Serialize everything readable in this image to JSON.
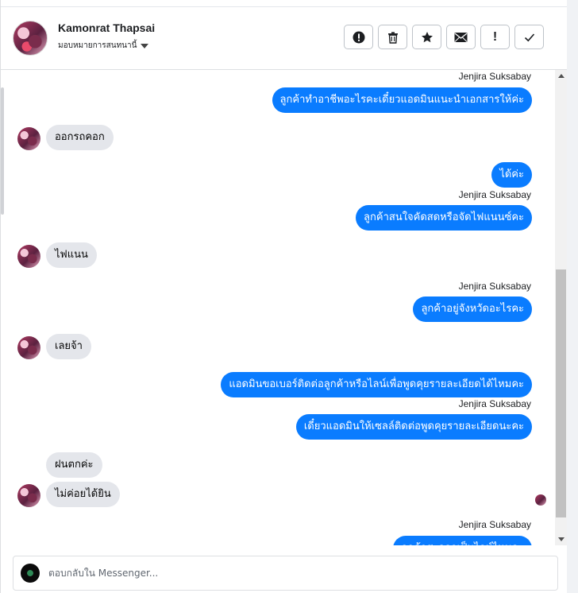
{
  "header": {
    "contact_name": "Kamonrat Thapsai",
    "assign_label": "มอบหมายการสนทนานี้",
    "toolbar": [
      {
        "name": "spam-button",
        "icon": "alert-circle-icon"
      },
      {
        "name": "delete-button",
        "icon": "trash-icon"
      },
      {
        "name": "star-button",
        "icon": "star-icon"
      },
      {
        "name": "unread-button",
        "icon": "envelope-icon"
      },
      {
        "name": "follow-up-button",
        "icon": "exclamation-icon",
        "glyph": "!"
      },
      {
        "name": "done-button",
        "icon": "check-icon"
      }
    ]
  },
  "messages": {
    "m1_sender": "Jenjira Suksabay",
    "m1_text": "ลูกค้าทำอาชีพอะไรคะเดี๋ยวแอดมินแนะนำเอกสารให้ค่ะ",
    "m2_text": "ออกรถคอก",
    "m3_text": "ได้ค่ะ",
    "m4_sender": "Jenjira Suksabay",
    "m4_text": "ลูกค้าสนใจคัดสดหรือจัดไฟแนนซ์คะ",
    "m5_text": "ไฟแนน",
    "m6_sender": "Jenjira Suksabay",
    "m6_text": "ลูกค้าอยู่จังหวัดอะไรคะ",
    "m7_text": "เลยจ้า",
    "m8_text": "แอดมินขอเบอร์ติดต่อลูกค้าหรือไลน์เพื่อพูดคุยรายละเอียดได้ไหมคะ",
    "m9_sender": "Jenjira Suksabay",
    "m9_text": "เดี๋ยวแอดมินให้เซลล์ติดต่อพูดคุยรายละเอียดนะคะ",
    "m10_text": "ฝนตกค่ะ",
    "m11_text": "ไม่ค่อยได้ยิน",
    "m12_sender": "Jenjira Suksabay",
    "m12_text": "ลูกค้าสะดวกเป็นไลน์ไหมคะ"
  },
  "composer": {
    "placeholder": "ตอบกลับใน Messenger..."
  },
  "colors": {
    "outgoing_bubble": "#0a7cff",
    "incoming_bubble": "#e4e6eb",
    "background": "#ffffff"
  }
}
